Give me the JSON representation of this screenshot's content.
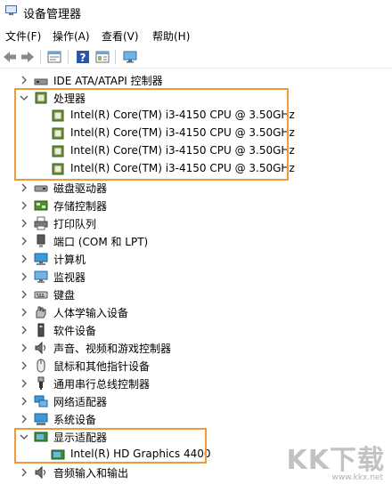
{
  "window": {
    "title": "设备管理器"
  },
  "menu": [
    "文件(F)",
    "操作(A)",
    "查看(V)",
    "帮助(H)"
  ],
  "toolbar": [
    "back-arrow-icon",
    "forward-arrow-icon",
    "properties-icon",
    "help-icon",
    "details-icon",
    "monitor-icon"
  ],
  "tree": {
    "ide": "IDE ATA/ATAPI 控制器",
    "processors": {
      "label": "处理器",
      "children": [
        "Intel(R) Core(TM) i3-4150 CPU @ 3.50GHz",
        "Intel(R) Core(TM) i3-4150 CPU @ 3.50GHz",
        "Intel(R) Core(TM) i3-4150 CPU @ 3.50GHz",
        "Intel(R) Core(TM) i3-4150 CPU @ 3.50GHz"
      ]
    },
    "items": [
      "磁盘驱动器",
      "存储控制器",
      "打印队列",
      "端口 (COM 和 LPT)",
      "计算机",
      "监视器",
      "键盘",
      "人体学输入设备",
      "软件设备",
      "声音、视频和游戏控制器",
      "鼠标和其他指针设备",
      "通用串行总线控制器",
      "网络适配器",
      "系统设备"
    ],
    "display": {
      "label": "显示适配器",
      "child": "Intel(R) HD Graphics 4400"
    },
    "audio": "音频输入和输出"
  },
  "watermark": {
    "text": "KK下载",
    "url": "www.kkx.net"
  },
  "colors": {
    "highlight": "#f0993a",
    "chevron": "#555555"
  }
}
